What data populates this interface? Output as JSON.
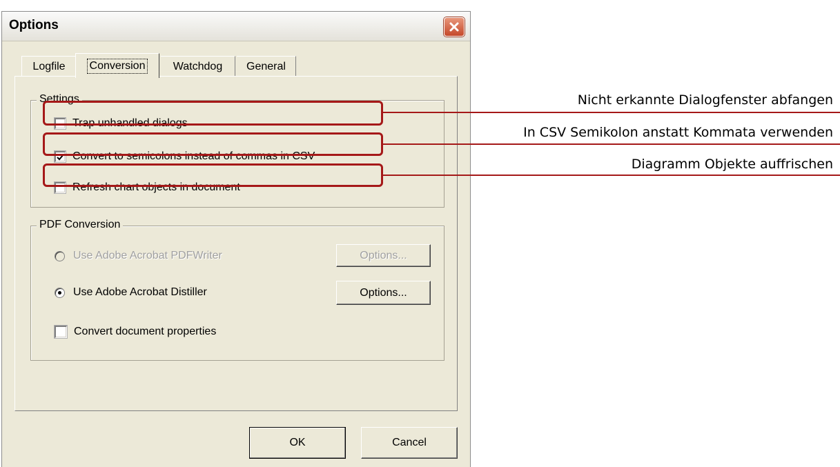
{
  "window": {
    "title": "Options"
  },
  "tabs": [
    {
      "label": "Logfile"
    },
    {
      "label": "Conversion"
    },
    {
      "label": "Watchdog"
    },
    {
      "label": "General"
    }
  ],
  "settings": {
    "legend": "Settings",
    "options": [
      {
        "label": "Trap unhandled dialogs",
        "checked": false
      },
      {
        "label": "Convert to semicolons instead of commas in CSV",
        "checked": true
      },
      {
        "label": "Refresh chart objects in document",
        "checked": false
      }
    ]
  },
  "pdf_conversion": {
    "legend": "PDF Conversion",
    "pdfwriter_label": "Use Adobe Acrobat PDFWriter",
    "distiller_label": "Use Adobe Acrobat Distiller",
    "options_label": "Options...",
    "convert_props_label": "Convert document properties",
    "selected": "distiller"
  },
  "footer": {
    "ok_label": "OK",
    "cancel_label": "Cancel"
  },
  "annotations": [
    "Nicht erkannte Dialogfenster abfangen",
    "In CSV Semikolon anstatt Kommata verwenden",
    "Diagramm Objekte auffrischen"
  ],
  "colors": {
    "annotation_red": "#a51818",
    "dialog_bg": "#ece9d8"
  }
}
